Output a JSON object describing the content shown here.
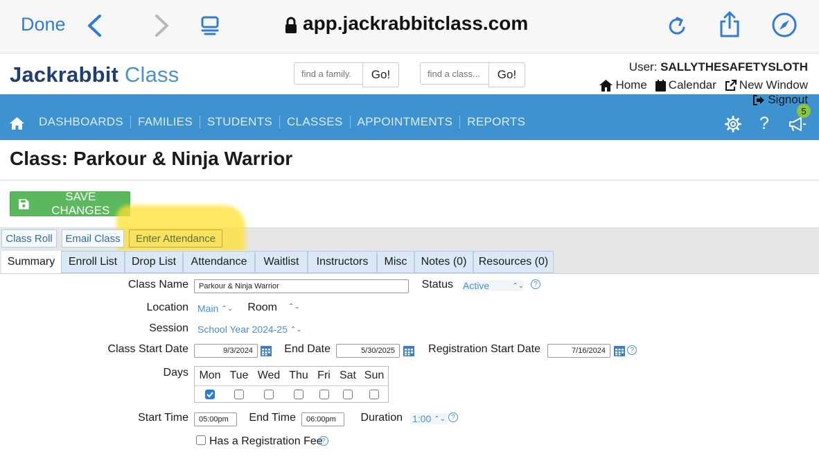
{
  "browser": {
    "done_label": "Done",
    "url": "app.jackrabbitclass.com"
  },
  "header": {
    "logo_main": "Jackrabbit",
    "logo_sub": "Class",
    "family_search_placeholder": "find a family.",
    "class_search_placeholder": "find a class...",
    "go_label": "Go!",
    "user_label": "User:",
    "user_name": "SALLYTHESAFETYSLOTH",
    "links": {
      "home": "Home",
      "calendar": "Calendar",
      "new_window": "New Window",
      "signout": "Signout"
    }
  },
  "nav": {
    "items": [
      "DASHBOARDS",
      "FAMILIES",
      "STUDENTS",
      "CLASSES",
      "APPOINTMENTS",
      "REPORTS"
    ],
    "notification_count": "5",
    "colors": {
      "nav_bg": "#3d92cf",
      "save_green": "#5cb85c",
      "highlight": "#ffe230"
    }
  },
  "page": {
    "title": "Class: Parkour & Ninja Warrior",
    "save_label": "SAVE CHANGES"
  },
  "actions": {
    "class_roll": "Class Roll",
    "email_class": "Email Class",
    "enter_attendance": "Enter Attendance"
  },
  "tabs": [
    "Summary",
    "Enroll List",
    "Drop List",
    "Attendance",
    "Waitlist",
    "Instructors",
    "Misc",
    "Notes (0)",
    "Resources (0)"
  ],
  "form": {
    "class_name_label": "Class Name",
    "class_name_value": "Parkour & Ninja Warrior",
    "status_label": "Status",
    "status_value": "Active",
    "location_label": "Location",
    "location_value": "Main",
    "room_label": "Room",
    "session_label": "Session",
    "session_value": "School Year 2024-25",
    "class_start_label": "Class Start Date",
    "class_start_value": "9/3/2024",
    "end_date_label": "End Date",
    "end_date_value": "5/30/2025",
    "reg_start_label": "Registration Start Date",
    "reg_start_value": "7/16/2024",
    "days_label": "Days",
    "days": [
      "Mon",
      "Tue",
      "Wed",
      "Thu",
      "Fri",
      "Sat",
      "Sun"
    ],
    "days_checked": [
      true,
      false,
      false,
      false,
      false,
      false,
      false
    ],
    "start_time_label": "Start Time",
    "start_time_value": "05:00pm",
    "end_time_label": "End Time",
    "end_time_value": "06:00pm",
    "duration_label": "Duration",
    "duration_value": "1:00",
    "reg_fee_label": "Has a Registration Fee"
  }
}
